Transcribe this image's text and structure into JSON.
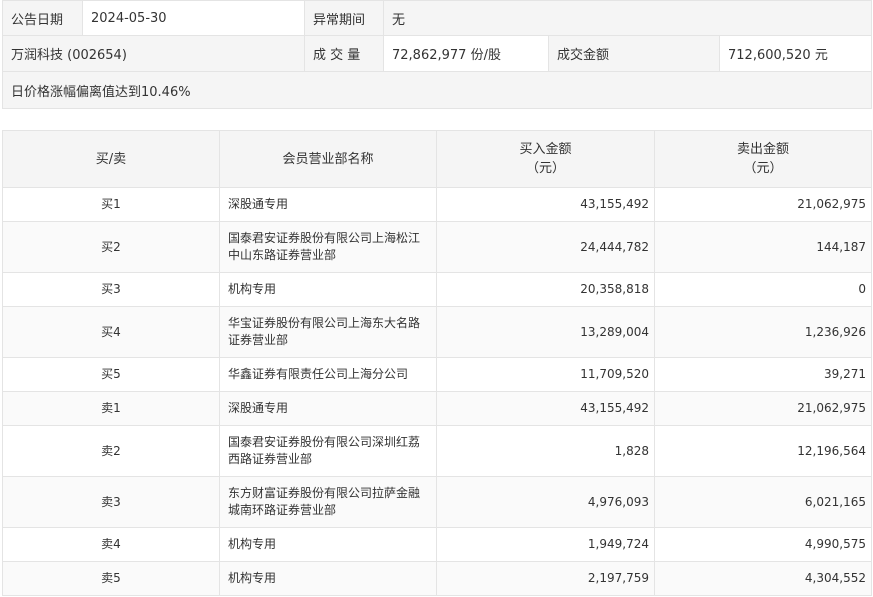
{
  "info": {
    "date_label": "公告日期",
    "date_value": "2024-05-30",
    "period_label": "异常期间",
    "period_value": "无",
    "stock": "万润科技 (002654)",
    "volume_label": "成 交 量",
    "volume_value": "72,862,977 份/股",
    "amount_label": "成交金额",
    "amount_value": "712,600,520 元",
    "reason": "日价格涨幅偏离值达到10.46%"
  },
  "table": {
    "headers": {
      "side": "买/卖",
      "name": "会员营业部名称",
      "buy_line1": "买入金额",
      "buy_line2": "（元）",
      "sell_line1": "卖出金额",
      "sell_line2": "（元）"
    },
    "rows": [
      {
        "side": "买1",
        "name": "深股通专用",
        "buy": "43,155,492",
        "sell": "21,062,975"
      },
      {
        "side": "买2",
        "name": "国泰君安证券股份有限公司上海松江中山东路证券营业部",
        "buy": "24,444,782",
        "sell": "144,187"
      },
      {
        "side": "买3",
        "name": "机构专用",
        "buy": "20,358,818",
        "sell": "0"
      },
      {
        "side": "买4",
        "name": "华宝证券股份有限公司上海东大名路证券营业部",
        "buy": "13,289,004",
        "sell": "1,236,926"
      },
      {
        "side": "买5",
        "name": "华鑫证券有限责任公司上海分公司",
        "buy": "11,709,520",
        "sell": "39,271"
      },
      {
        "side": "卖1",
        "name": "深股通专用",
        "buy": "43,155,492",
        "sell": "21,062,975"
      },
      {
        "side": "卖2",
        "name": "国泰君安证券股份有限公司深圳红荔西路证券营业部",
        "buy": "1,828",
        "sell": "12,196,564"
      },
      {
        "side": "卖3",
        "name": "东方财富证券股份有限公司拉萨金融城南环路证券营业部",
        "buy": "4,976,093",
        "sell": "6,021,165"
      },
      {
        "side": "卖4",
        "name": "机构专用",
        "buy": "1,949,724",
        "sell": "4,990,575"
      },
      {
        "side": "卖5",
        "name": "机构专用",
        "buy": "2,197,759",
        "sell": "4,304,552"
      }
    ]
  }
}
